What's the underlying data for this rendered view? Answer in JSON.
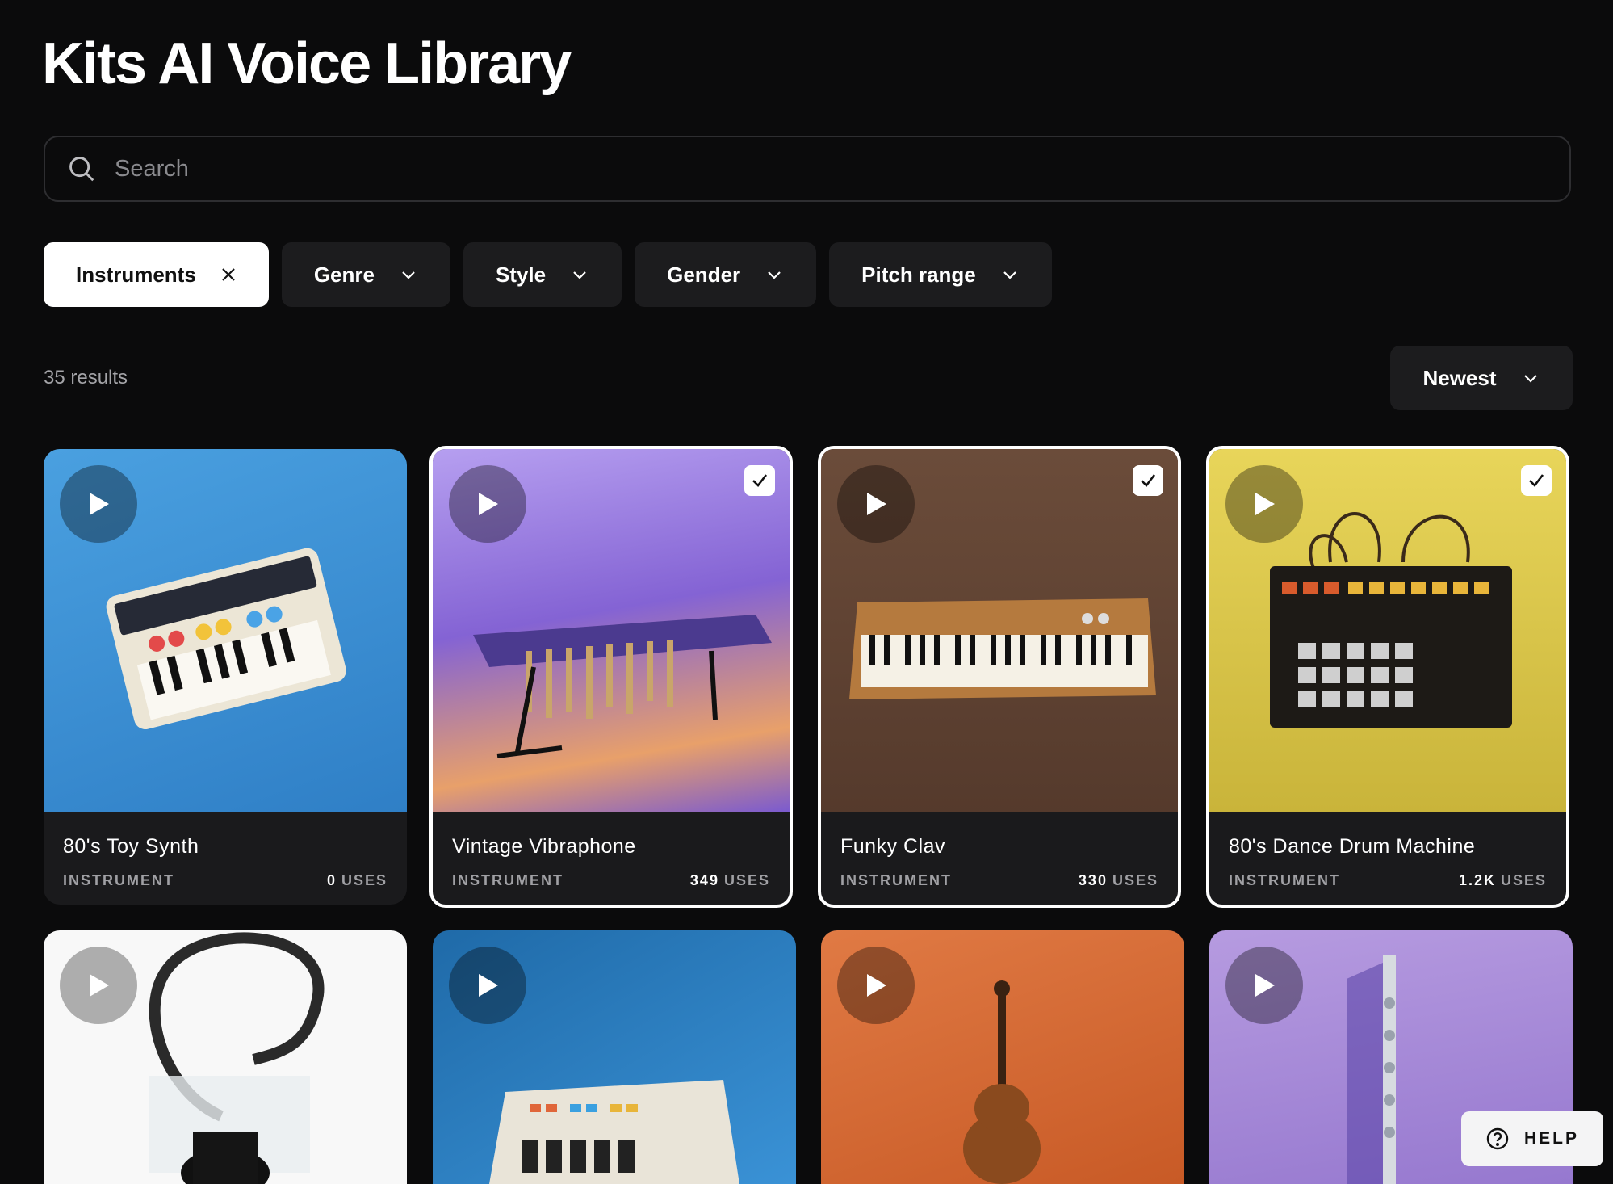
{
  "page": {
    "title": "Kits AI Voice Library"
  },
  "search": {
    "placeholder": "Search"
  },
  "filters": [
    {
      "label": "Instruments",
      "active": true,
      "icon": "close-icon"
    },
    {
      "label": "Genre",
      "active": false,
      "icon": "chevron-down-icon"
    },
    {
      "label": "Style",
      "active": false,
      "icon": "chevron-down-icon"
    },
    {
      "label": "Gender",
      "active": false,
      "icon": "chevron-down-icon"
    },
    {
      "label": "Pitch range",
      "active": false,
      "icon": "chevron-down-icon"
    }
  ],
  "results": {
    "count_text": "35 results"
  },
  "sort": {
    "label": "Newest"
  },
  "cards": [
    {
      "name": "80's Toy Synth",
      "type": "INSTRUMENT",
      "uses_value": "0",
      "uses_label": "USES",
      "selected": false,
      "bg": "#3a8fd1"
    },
    {
      "name": "Vintage Vibraphone",
      "type": "INSTRUMENT",
      "uses_value": "349",
      "uses_label": "USES",
      "selected": true,
      "bg": "#8a66d6"
    },
    {
      "name": "Funky Clav",
      "type": "INSTRUMENT",
      "uses_value": "330",
      "uses_label": "USES",
      "selected": true,
      "bg": "#6a4a38"
    },
    {
      "name": "80's Dance Drum Machine",
      "type": "INSTRUMENT",
      "uses_value": "1.2K",
      "uses_label": "USES",
      "selected": true,
      "bg": "#d8c64a"
    },
    {
      "bg": "#f7f7f7",
      "selected": false
    },
    {
      "bg": "#2b7fc2",
      "selected": false
    },
    {
      "bg": "#d66a34",
      "selected": false
    },
    {
      "bg": "#a58ad6",
      "selected": false
    }
  ],
  "help": {
    "label": "HELP"
  },
  "colors": {
    "background": "#0b0b0c",
    "chip": "#1c1c1e",
    "card": "#1a1a1c"
  }
}
